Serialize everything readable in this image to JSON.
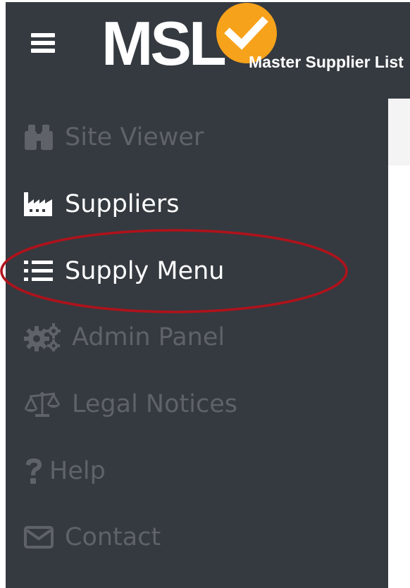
{
  "header": {
    "menu_icon": "hamburger-menu-icon",
    "logo_text": "MSL",
    "logo_badge_icon": "checkmark-circle-icon",
    "logo_tagline": "Master Supplier List"
  },
  "sidebar": {
    "items": [
      {
        "label": "Site Viewer",
        "icon": "binoculars-icon",
        "state": "dimmed"
      },
      {
        "label": "Suppliers",
        "icon": "factory-icon",
        "state": "active"
      },
      {
        "label": "Supply Menu",
        "icon": "list-icon",
        "state": "active",
        "annotated": "circled"
      },
      {
        "label": "Admin Panel",
        "icon": "gears-icon",
        "state": "dimmed"
      },
      {
        "label": "Legal Notices",
        "icon": "balance-scale-icon",
        "state": "dimmed"
      },
      {
        "label": "Help",
        "icon": "question-mark-icon",
        "state": "dimmed"
      },
      {
        "label": "Contact",
        "icon": "envelope-icon",
        "state": "dimmed"
      }
    ]
  },
  "colors": {
    "sidebar_bg": "#353a40",
    "text_active": "#ffffff",
    "text_dimmed": "#5f6369",
    "logo_badge": "#f7a21b",
    "annotation": "#b0121b"
  }
}
